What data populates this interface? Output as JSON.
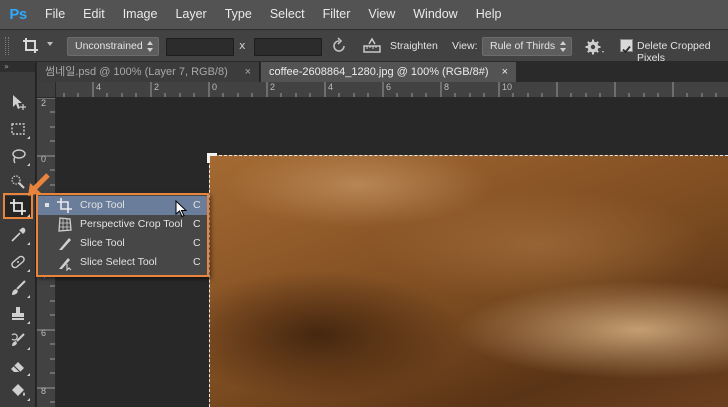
{
  "app": {
    "logo": "Ps",
    "menu": [
      "File",
      "Edit",
      "Image",
      "Layer",
      "Type",
      "Select",
      "Filter",
      "View",
      "Window",
      "Help"
    ]
  },
  "options_bar": {
    "ratio_preset": "Unconstrained",
    "ratio_separator": "x",
    "straighten_label": "Straighten",
    "view_label": "View:",
    "view_value": "Rule of Thirds",
    "delete_cropped_label": "Delete Cropped Pixels",
    "delete_cropped_checked": true
  },
  "toolbox": {
    "collapse_label": "»",
    "tools": [
      "move-tool",
      "marquee-tool",
      "lasso-tool",
      "quick-selection-tool",
      "crop-tool",
      "eyedropper-tool",
      "healing-brush-tool",
      "brush-tool",
      "clone-stamp-tool",
      "history-brush-tool",
      "eraser-tool",
      "paint-bucket-tool"
    ],
    "active_tool": "crop-tool"
  },
  "tabs": [
    {
      "label": "썸네일.psd @ 100% (Layer 7, RGB/8)",
      "close": "×",
      "active": false
    },
    {
      "label": "coffee-2608864_1280.jpg @ 100% (RGB/8#)",
      "close": "×",
      "active": true
    }
  ],
  "rulers": {
    "horizontal_labels": [
      "4",
      "2",
      "0",
      "2",
      "4",
      "6",
      "8",
      "10"
    ],
    "vertical_labels": [
      "2",
      "0",
      "2",
      "4",
      "6",
      "8"
    ]
  },
  "flyout": {
    "items": [
      {
        "label": "Crop Tool",
        "key": "C",
        "selected": true,
        "icon": "crop-icon"
      },
      {
        "label": "Perspective Crop Tool",
        "key": "C",
        "selected": false,
        "icon": "perspective-crop-icon"
      },
      {
        "label": "Slice Tool",
        "key": "C",
        "selected": false,
        "icon": "slice-icon"
      },
      {
        "label": "Slice Select Tool",
        "key": "C",
        "selected": false,
        "icon": "slice-select-icon"
      }
    ]
  },
  "colors": {
    "highlight": "#e8843c",
    "selection": "#6a7d9a",
    "menubar": "#535353",
    "logo": "#31a8ff"
  }
}
